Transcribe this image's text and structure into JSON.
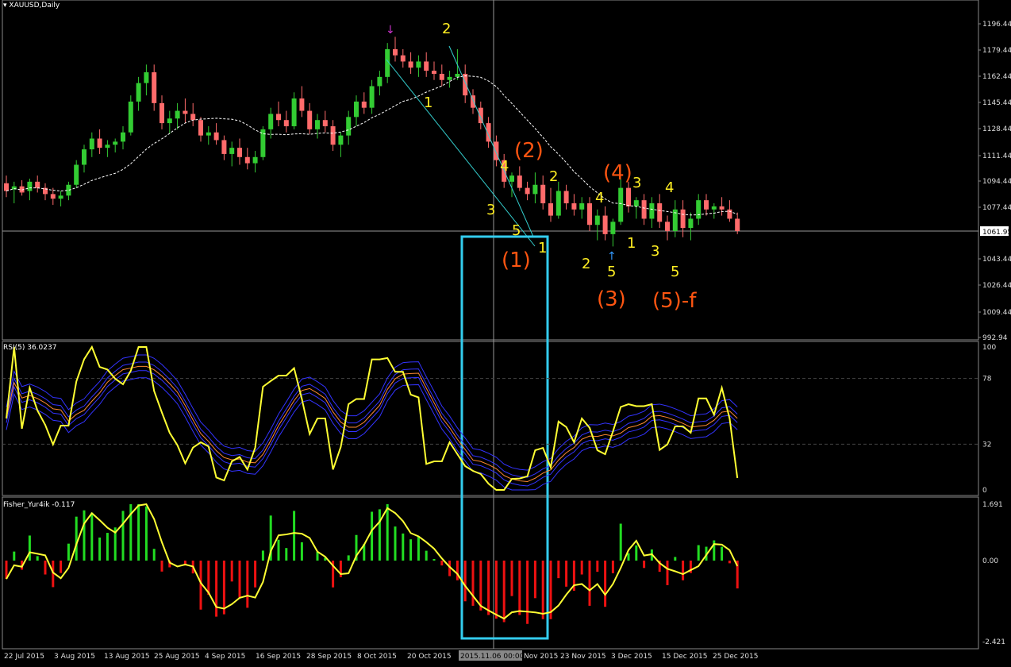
{
  "window": {
    "title": "XAUUSD,Daily"
  },
  "colors": {
    "bg": "#000000",
    "bull": "#33cc33",
    "bear": "#ff6b6b",
    "ma": "#ffffff",
    "fib_line": "#33cccc",
    "box": "#33ccee",
    "wave_minor": "#ffee22",
    "wave_major": "#ff5511",
    "rsi": "#ffff33",
    "bands": "#3333ff",
    "orange": "#ff8833",
    "fisher_pos": "#22dd22",
    "fisher_neg": "#ee1111"
  },
  "price_axis": {
    "labels": [
      "1196.44",
      "1179.44",
      "1162.44",
      "1145.44",
      "1128.44",
      "1111.44",
      "1094.44",
      "1077.44",
      "1061.95",
      "1043.44",
      "1026.44",
      "1009.44",
      "992.94"
    ],
    "current": "1061.95"
  },
  "rsi_panel": {
    "label": "RSI(5) 36.0237",
    "levels": [
      "100",
      "78",
      "32",
      "0"
    ]
  },
  "fisher_panel": {
    "label": "Fisher_Yur4ik -0.117",
    "levels": [
      "1.691",
      "0.00",
      "-2.421"
    ]
  },
  "time_axis": {
    "labels": [
      "22 Jul 2015",
      "3 Aug 2015",
      "13 Aug 2015",
      "25 Aug 2015",
      "4 Sep 2015",
      "16 Sep 2015",
      "28 Sep 2015",
      "8 Oct 2015",
      "20 Oct 2015",
      "2015.11.06 00:00",
      "Nov 2015",
      "23 Nov 2015",
      "3 Dec 2015",
      "15 Dec 2015",
      "25 Dec 2015"
    ]
  },
  "waves": {
    "minor": [
      "2",
      "1",
      "4",
      "3",
      "5",
      "1",
      "2",
      "4",
      "2",
      "3",
      "5",
      "1",
      "4",
      "3",
      "5"
    ],
    "major": [
      "(2)",
      "(1)",
      "(4)",
      "(3)",
      "(5)-f"
    ]
  },
  "chart_data": {
    "type": "candlestick",
    "ylim": [
      992.94,
      1200
    ],
    "candles_ohlc": [
      [
        1093,
        1098,
        1084,
        1088
      ],
      [
        1089,
        1094,
        1080,
        1091
      ],
      [
        1091,
        1095,
        1085,
        1087
      ],
      [
        1088,
        1096,
        1082,
        1094
      ],
      [
        1094,
        1098,
        1087,
        1090
      ],
      [
        1090,
        1093,
        1082,
        1086
      ],
      [
        1086,
        1090,
        1079,
        1083
      ],
      [
        1083,
        1088,
        1078,
        1085
      ],
      [
        1085,
        1094,
        1082,
        1092
      ],
      [
        1092,
        1108,
        1090,
        1105
      ],
      [
        1105,
        1118,
        1100,
        1115
      ],
      [
        1115,
        1126,
        1110,
        1122
      ],
      [
        1122,
        1128,
        1112,
        1116
      ],
      [
        1116,
        1121,
        1110,
        1118
      ],
      [
        1118,
        1122,
        1113,
        1120
      ],
      [
        1120,
        1130,
        1115,
        1126
      ],
      [
        1126,
        1150,
        1124,
        1146
      ],
      [
        1146,
        1162,
        1140,
        1158
      ],
      [
        1158,
        1170,
        1150,
        1165
      ],
      [
        1165,
        1170,
        1140,
        1145
      ],
      [
        1145,
        1150,
        1128,
        1132
      ],
      [
        1132,
        1140,
        1125,
        1135
      ],
      [
        1135,
        1145,
        1128,
        1140
      ],
      [
        1140,
        1148,
        1132,
        1138
      ],
      [
        1138,
        1145,
        1130,
        1134
      ],
      [
        1134,
        1136,
        1120,
        1124
      ],
      [
        1124,
        1130,
        1118,
        1126
      ],
      [
        1126,
        1132,
        1118,
        1121
      ],
      [
        1121,
        1124,
        1108,
        1112
      ],
      [
        1112,
        1120,
        1104,
        1116
      ],
      [
        1116,
        1122,
        1105,
        1110
      ],
      [
        1110,
        1116,
        1102,
        1106
      ],
      [
        1106,
        1114,
        1100,
        1110
      ],
      [
        1110,
        1130,
        1108,
        1128
      ],
      [
        1128,
        1142,
        1122,
        1138
      ],
      [
        1138,
        1146,
        1130,
        1134
      ],
      [
        1134,
        1140,
        1126,
        1130
      ],
      [
        1130,
        1152,
        1128,
        1148
      ],
      [
        1148,
        1156,
        1136,
        1140
      ],
      [
        1140,
        1145,
        1125,
        1128
      ],
      [
        1128,
        1138,
        1122,
        1134
      ],
      [
        1134,
        1140,
        1126,
        1130
      ],
      [
        1130,
        1134,
        1114,
        1118
      ],
      [
        1118,
        1126,
        1110,
        1124
      ],
      [
        1124,
        1140,
        1118,
        1136
      ],
      [
        1136,
        1150,
        1130,
        1146
      ],
      [
        1146,
        1152,
        1138,
        1142
      ],
      [
        1142,
        1160,
        1138,
        1156
      ],
      [
        1156,
        1166,
        1150,
        1162
      ],
      [
        1162,
        1184,
        1158,
        1180
      ],
      [
        1180,
        1188,
        1172,
        1176
      ],
      [
        1176,
        1180,
        1168,
        1172
      ],
      [
        1172,
        1178,
        1164,
        1168
      ],
      [
        1168,
        1176,
        1162,
        1172
      ],
      [
        1172,
        1178,
        1162,
        1166
      ],
      [
        1166,
        1172,
        1160,
        1164
      ],
      [
        1164,
        1170,
        1156,
        1160
      ],
      [
        1160,
        1166,
        1155,
        1162
      ],
      [
        1162,
        1180,
        1160,
        1164
      ],
      [
        1164,
        1170,
        1145,
        1150
      ],
      [
        1150,
        1154,
        1138,
        1142
      ],
      [
        1142,
        1146,
        1128,
        1132
      ],
      [
        1132,
        1136,
        1116,
        1120
      ],
      [
        1120,
        1124,
        1104,
        1108
      ],
      [
        1108,
        1112,
        1090,
        1094
      ],
      [
        1094,
        1100,
        1084,
        1098
      ],
      [
        1098,
        1104,
        1088,
        1090
      ],
      [
        1090,
        1094,
        1082,
        1086
      ],
      [
        1086,
        1100,
        1080,
        1092
      ],
      [
        1092,
        1098,
        1076,
        1080
      ],
      [
        1080,
        1090,
        1068,
        1072
      ],
      [
        1072,
        1094,
        1070,
        1088
      ],
      [
        1088,
        1092,
        1076,
        1080
      ],
      [
        1080,
        1086,
        1072,
        1076
      ],
      [
        1076,
        1084,
        1070,
        1080
      ],
      [
        1080,
        1084,
        1062,
        1066
      ],
      [
        1066,
        1076,
        1056,
        1072
      ],
      [
        1072,
        1078,
        1056,
        1060
      ],
      [
        1060,
        1070,
        1052,
        1068
      ],
      [
        1068,
        1096,
        1066,
        1090
      ],
      [
        1090,
        1094,
        1074,
        1078
      ],
      [
        1078,
        1084,
        1070,
        1082
      ],
      [
        1082,
        1086,
        1066,
        1070
      ],
      [
        1070,
        1084,
        1064,
        1080
      ],
      [
        1080,
        1086,
        1064,
        1068
      ],
      [
        1068,
        1072,
        1056,
        1062
      ],
      [
        1062,
        1082,
        1058,
        1076
      ],
      [
        1076,
        1082,
        1058,
        1064
      ],
      [
        1064,
        1074,
        1056,
        1070
      ],
      [
        1070,
        1086,
        1066,
        1082
      ],
      [
        1082,
        1086,
        1072,
        1076
      ],
      [
        1076,
        1080,
        1070,
        1078
      ],
      [
        1078,
        1084,
        1072,
        1076
      ],
      [
        1076,
        1082,
        1068,
        1070
      ],
      [
        1070,
        1074,
        1060,
        1062
      ]
    ]
  }
}
